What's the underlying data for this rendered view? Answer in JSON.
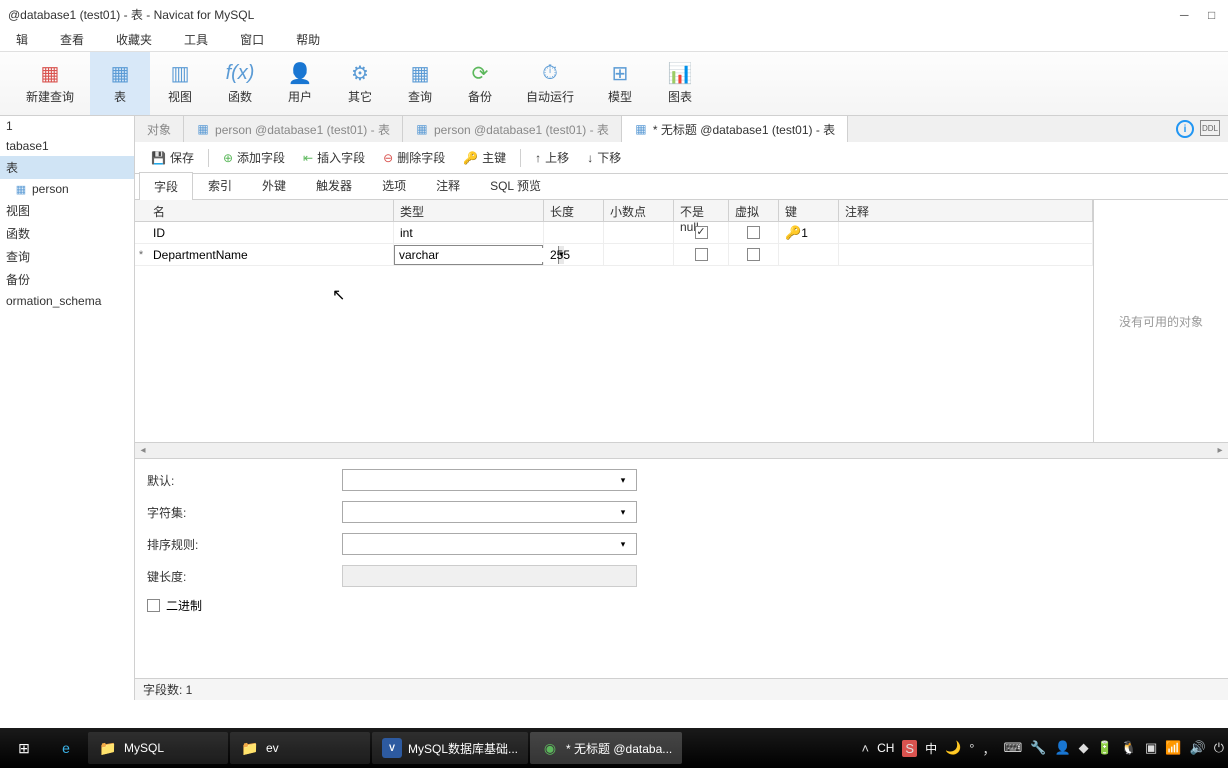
{
  "title": "@database1 (test01) - 表 - Navicat for MySQL",
  "menu": {
    "items": [
      "辑",
      "查看",
      "收藏夹",
      "工具",
      "窗口",
      "帮助"
    ]
  },
  "toolbar": [
    {
      "label": "新建查询",
      "color": "#d9534f"
    },
    {
      "label": "表",
      "active": true,
      "color": "#5b9bd5"
    },
    {
      "label": "视图",
      "color": "#5b9bd5"
    },
    {
      "label": "函数",
      "color": "#5b9bd5"
    },
    {
      "label": "用户",
      "color": "#e6a817"
    },
    {
      "label": "其它",
      "color": "#5b9bd5"
    },
    {
      "label": "查询",
      "color": "#5b9bd5"
    },
    {
      "label": "备份",
      "color": "#5cb85c"
    },
    {
      "label": "自动运行",
      "color": "#5b9bd5"
    },
    {
      "label": "模型",
      "color": "#5b9bd5"
    },
    {
      "label": "图表",
      "color": "#5b9bd5"
    }
  ],
  "sidebar": {
    "items": [
      {
        "label": "1"
      },
      {
        "label": "tabase1"
      },
      {
        "label": "表",
        "selected": true
      },
      {
        "label": "person",
        "icon": "table"
      },
      {
        "label": "视图"
      },
      {
        "label": "函数"
      },
      {
        "label": "查询"
      },
      {
        "label": "备份"
      },
      {
        "label": "ormation_schema"
      }
    ]
  },
  "tabs": [
    {
      "label": "对象"
    },
    {
      "label": "person @database1 (test01) - 表",
      "icon": "table"
    },
    {
      "label": "person @database1 (test01) - 表",
      "icon": "table"
    },
    {
      "label": "* 无标题 @database1 (test01) - 表",
      "icon": "table-new",
      "active": true
    }
  ],
  "actions": {
    "save": "保存",
    "add_field": "添加字段",
    "insert_field": "插入字段",
    "delete_field": "删除字段",
    "primary_key": "主键",
    "move_up": "上移",
    "move_down": "下移"
  },
  "subtabs": [
    "字段",
    "索引",
    "外键",
    "触发器",
    "选项",
    "注释",
    "SQL 预览"
  ],
  "grid": {
    "headers": {
      "name": "名",
      "type": "类型",
      "length": "长度",
      "decimals": "小数点",
      "not_null": "不是 null",
      "virtual": "虚拟",
      "key": "键",
      "comment": "注释"
    },
    "rows": [
      {
        "name": "ID",
        "type": "int",
        "length": "",
        "not_null": true,
        "virtual": false,
        "key": "1"
      },
      {
        "marker": "*",
        "name": "DepartmentName",
        "type": "varchar",
        "length": "255",
        "not_null": false,
        "virtual": false,
        "editing": true
      }
    ]
  },
  "right_panel": {
    "text": "没有可用的对象"
  },
  "properties": {
    "default": {
      "label": "默认:"
    },
    "charset": {
      "label": "字符集:"
    },
    "collation": {
      "label": "排序规则:"
    },
    "key_length": {
      "label": "键长度:"
    },
    "binary": {
      "label": "二进制"
    }
  },
  "status": {
    "field_count": "字段数: 1"
  },
  "taskbar": {
    "items": [
      {
        "label": "MySQL",
        "icon": "folder"
      },
      {
        "label": "ev",
        "icon": "folder"
      },
      {
        "label": "MySQL数据库基础...",
        "icon": "vbox"
      },
      {
        "label": "* 无标题 @databa...",
        "icon": "navicat",
        "active": true
      }
    ],
    "tray": {
      "ime": "CH",
      "lang": "中"
    }
  }
}
